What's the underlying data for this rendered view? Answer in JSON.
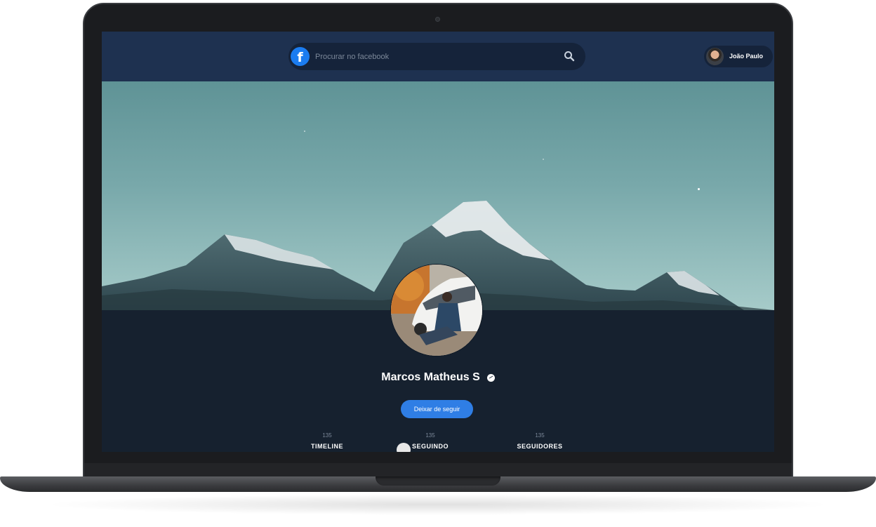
{
  "search": {
    "placeholder": "Procurar no facebook"
  },
  "header": {
    "user_name": "João Paulo"
  },
  "profile": {
    "name": "Marcos Matheus S",
    "unfollow_label": "Deixar de seguir"
  },
  "stats": [
    {
      "count": "135",
      "label": "TIMELINE"
    },
    {
      "count": "135",
      "label": "SEGUINDO"
    },
    {
      "count": "135",
      "label": "SEGUIDORES"
    }
  ],
  "icons": [
    "facebook-logo-icon",
    "search-icon",
    "messenger-icon"
  ],
  "colors": {
    "header_bg": "#1e3150",
    "page_bg": "#16212f",
    "accent": "#2f7ee5"
  }
}
